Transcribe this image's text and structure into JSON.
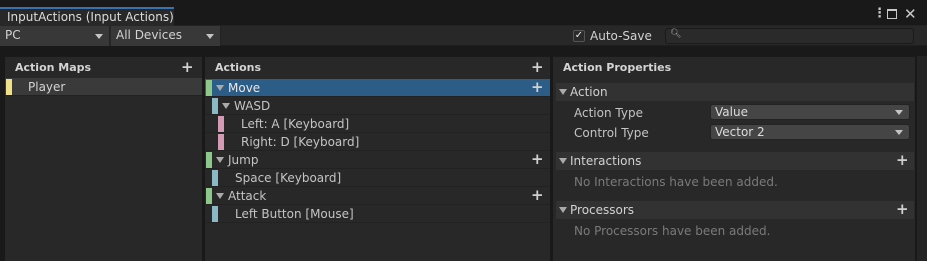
{
  "window": {
    "tab_title": "InputActions (Input Actions)",
    "menu_icon": "kebab-menu-icon",
    "maximize_icon": "maximize-icon",
    "close_icon": "close-icon"
  },
  "toolbar": {
    "scheme": "PC",
    "devices": "All Devices",
    "auto_save_label": "Auto-Save",
    "auto_save_checked": true,
    "search_value": "",
    "search_icon": "search-icon"
  },
  "action_maps": {
    "header": "Action Maps",
    "items": [
      {
        "label": "Player",
        "color": "#f0e08a"
      }
    ]
  },
  "actions": {
    "header": "Actions",
    "rows": [
      {
        "label": "Move",
        "kind": "action",
        "selected": true
      },
      {
        "label": "WASD",
        "kind": "composite"
      },
      {
        "label": "Left: A [Keyboard]",
        "kind": "part"
      },
      {
        "label": "Right: D [Keyboard]",
        "kind": "part"
      },
      {
        "label": "Jump",
        "kind": "action"
      },
      {
        "label": "Space [Keyboard]",
        "kind": "binding"
      },
      {
        "label": "Attack",
        "kind": "action"
      },
      {
        "label": "Left Button [Mouse]",
        "kind": "binding"
      }
    ],
    "colors": {
      "action": "#8dc88a",
      "binding": "#8ab8c4",
      "part": "#d39bb3"
    }
  },
  "properties": {
    "header": "Action Properties",
    "action_section": "Action",
    "action_type_label": "Action Type",
    "action_type_value": "Value",
    "control_type_label": "Control Type",
    "control_type_value": "Vector 2",
    "interactions_section": "Interactions",
    "interactions_empty": "No Interactions have been added.",
    "processors_section": "Processors",
    "processors_empty": "No Processors have been added."
  }
}
